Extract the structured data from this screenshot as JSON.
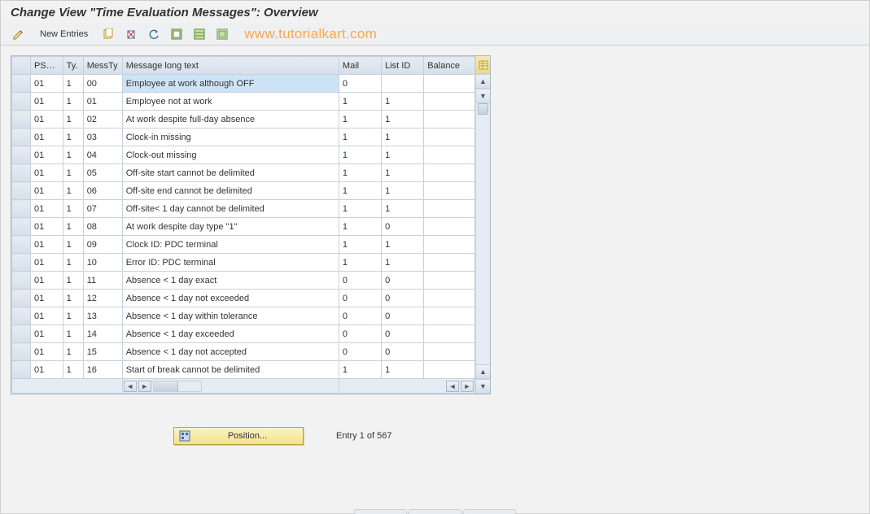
{
  "title": "Change View \"Time Evaluation Messages\": Overview",
  "toolbar": {
    "new_entries": "New Entries"
  },
  "watermark": "www.tutorialkart.com",
  "columns": {
    "psg": "PSG...",
    "ty": "Ty.",
    "messty": "MessTy",
    "text": "Message long text",
    "mail": "Mail",
    "list": "List ID",
    "balance": "Balance"
  },
  "rows": [
    {
      "psg": "01",
      "ty": "1",
      "messty": "00",
      "text": "Employee at work although OFF",
      "mail": "0",
      "list": "",
      "bal": "",
      "selected": true
    },
    {
      "psg": "01",
      "ty": "1",
      "messty": "01",
      "text": "Employee not at work",
      "mail": "1",
      "list": "1",
      "bal": ""
    },
    {
      "psg": "01",
      "ty": "1",
      "messty": "02",
      "text": "At work despite full-day absence",
      "mail": "1",
      "list": "1",
      "bal": ""
    },
    {
      "psg": "01",
      "ty": "1",
      "messty": "03",
      "text": "Clock-in missing",
      "mail": "1",
      "list": "1",
      "bal": ""
    },
    {
      "psg": "01",
      "ty": "1",
      "messty": "04",
      "text": "Clock-out missing",
      "mail": "1",
      "list": "1",
      "bal": ""
    },
    {
      "psg": "01",
      "ty": "1",
      "messty": "05",
      "text": "Off-site start cannot be delimited",
      "mail": "1",
      "list": "1",
      "bal": ""
    },
    {
      "psg": "01",
      "ty": "1",
      "messty": "06",
      "text": "Off-site end cannot be delimited",
      "mail": "1",
      "list": "1",
      "bal": ""
    },
    {
      "psg": "01",
      "ty": "1",
      "messty": "07",
      "text": "Off-site< 1 day cannot be delimited",
      "mail": "1",
      "list": "1",
      "bal": ""
    },
    {
      "psg": "01",
      "ty": "1",
      "messty": "08",
      "text": "At work despite day type \"1\"",
      "mail": "1",
      "list": "0",
      "bal": ""
    },
    {
      "psg": "01",
      "ty": "1",
      "messty": "09",
      "text": "Clock ID: PDC terminal",
      "mail": "1",
      "list": "1",
      "bal": ""
    },
    {
      "psg": "01",
      "ty": "1",
      "messty": "10",
      "text": "Error ID: PDC terminal",
      "mail": "1",
      "list": "1",
      "bal": ""
    },
    {
      "psg": "01",
      "ty": "1",
      "messty": "11",
      "text": "Absence < 1 day exact",
      "mail": "0",
      "list": "0",
      "bal": ""
    },
    {
      "psg": "01",
      "ty": "1",
      "messty": "12",
      "text": "Absence < 1 day not exceeded",
      "mail": "0",
      "list": "0",
      "bal": ""
    },
    {
      "psg": "01",
      "ty": "1",
      "messty": "13",
      "text": "Absence < 1 day within tolerance",
      "mail": "0",
      "list": "0",
      "bal": ""
    },
    {
      "psg": "01",
      "ty": "1",
      "messty": "14",
      "text": "Absence < 1 day exceeded",
      "mail": "0",
      "list": "0",
      "bal": ""
    },
    {
      "psg": "01",
      "ty": "1",
      "messty": "15",
      "text": "Absence < 1 day not accepted",
      "mail": "0",
      "list": "0",
      "bal": ""
    },
    {
      "psg": "01",
      "ty": "1",
      "messty": "16",
      "text": "Start of break cannot be delimited",
      "mail": "1",
      "list": "1",
      "bal": ""
    }
  ],
  "position_button": "Position...",
  "entry_counter": "Entry 1 of 567"
}
